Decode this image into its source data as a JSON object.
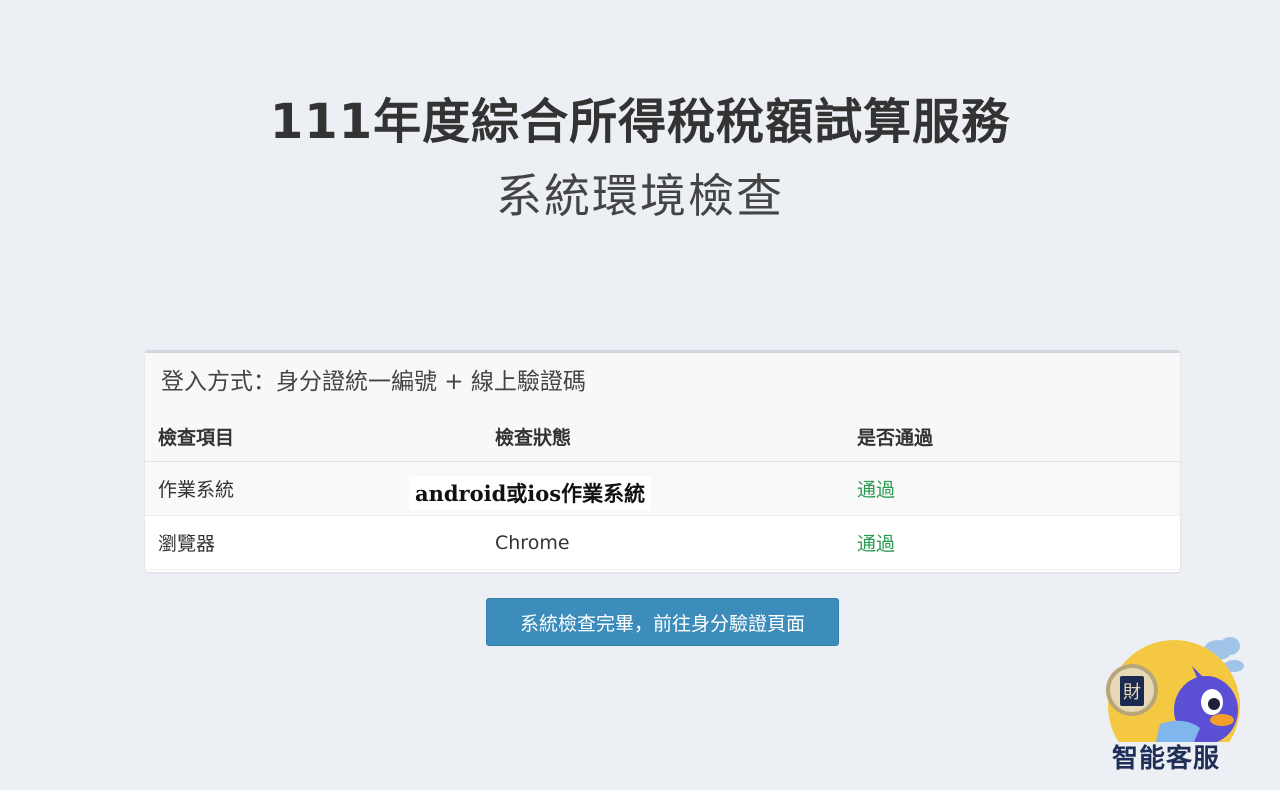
{
  "header": {
    "title": "111年度綜合所得稅稅額試算服務",
    "subtitle": "系統環境檢查"
  },
  "panel": {
    "login_method": "登入方式：身分證統一編號 + 線上驗證碼",
    "columns": [
      "檢查項目",
      "檢查狀態",
      "是否通過"
    ],
    "rows": [
      {
        "item": "作業系統",
        "status": "android或ios作業系統",
        "pass": "通過"
      },
      {
        "item": "瀏覽器",
        "status": "Chrome",
        "pass": "通過"
      }
    ]
  },
  "actions": {
    "proceed_label": "系統檢查完畢，前往身分驗證頁面"
  },
  "chatbot": {
    "label": "智能客服",
    "badge_text": "財"
  },
  "colors": {
    "background": "#eceff4",
    "primary_button": "#3c8dbc",
    "pass_text": "#2a9a52",
    "chatbot_circle": "#f5c842",
    "chatbot_bird": "#5b4fd6"
  }
}
